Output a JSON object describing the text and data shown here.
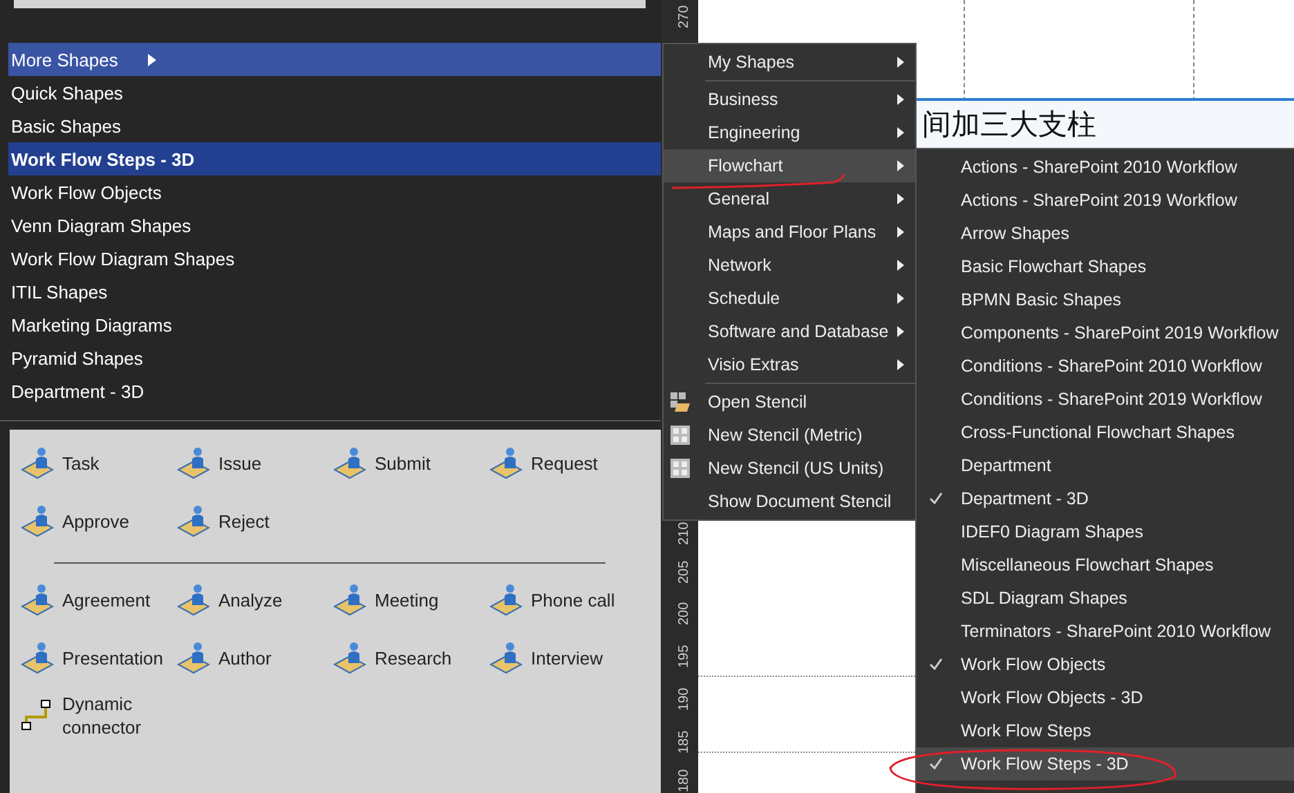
{
  "shape_categories": [
    {
      "label": "More Shapes",
      "open": true,
      "has_submenu": true,
      "selected": false
    },
    {
      "label": "Quick Shapes",
      "open": false,
      "has_submenu": false,
      "selected": false
    },
    {
      "label": "Basic Shapes",
      "open": false,
      "has_submenu": false,
      "selected": false
    },
    {
      "label": "Work Flow Steps - 3D",
      "open": false,
      "has_submenu": false,
      "selected": true
    },
    {
      "label": "Work Flow Objects",
      "open": false,
      "has_submenu": false,
      "selected": false
    },
    {
      "label": "Venn Diagram Shapes",
      "open": false,
      "has_submenu": false,
      "selected": false
    },
    {
      "label": "Work Flow Diagram Shapes",
      "open": false,
      "has_submenu": false,
      "selected": false
    },
    {
      "label": "ITIL Shapes",
      "open": false,
      "has_submenu": false,
      "selected": false
    },
    {
      "label": "Marketing Diagrams",
      "open": false,
      "has_submenu": false,
      "selected": false
    },
    {
      "label": "Pyramid Shapes",
      "open": false,
      "has_submenu": false,
      "selected": false
    },
    {
      "label": "Department - 3D",
      "open": false,
      "has_submenu": false,
      "selected": false
    }
  ],
  "stencil_groups": [
    [
      {
        "label": "Task",
        "kind": "figure"
      },
      {
        "label": "Issue",
        "kind": "figure"
      },
      {
        "label": "Submit",
        "kind": "figure"
      },
      {
        "label": "Request",
        "kind": "figure"
      },
      {
        "label": "Approve",
        "kind": "figure"
      },
      {
        "label": "Reject",
        "kind": "figure"
      }
    ],
    [
      {
        "label": "Agreement",
        "kind": "figure"
      },
      {
        "label": "Analyze",
        "kind": "figure"
      },
      {
        "label": "Meeting",
        "kind": "figure"
      },
      {
        "label": "Phone call",
        "kind": "figure"
      },
      {
        "label": "Presentation",
        "kind": "figure"
      },
      {
        "label": "Author",
        "kind": "figure"
      },
      {
        "label": "Research",
        "kind": "figure"
      },
      {
        "label": "Interview",
        "kind": "figure"
      },
      {
        "label": "Dynamic connector",
        "kind": "connector"
      }
    ]
  ],
  "ruler_labels": [
    "270",
    "210",
    "205",
    "200",
    "195",
    "190",
    "185",
    "180"
  ],
  "canvas_heading": "间加三大支柱",
  "more_shapes_menu": [
    {
      "label": "My Shapes",
      "kind": "submenu",
      "selected": false,
      "separator_after": true
    },
    {
      "label": "Business",
      "kind": "submenu",
      "selected": false,
      "separator_after": false
    },
    {
      "label": "Engineering",
      "kind": "submenu",
      "selected": false,
      "separator_after": false
    },
    {
      "label": "Flowchart",
      "kind": "submenu",
      "selected": true,
      "separator_after": false
    },
    {
      "label": "General",
      "kind": "submenu",
      "selected": false,
      "separator_after": false
    },
    {
      "label": "Maps and Floor Plans",
      "kind": "submenu",
      "selected": false,
      "separator_after": false
    },
    {
      "label": "Network",
      "kind": "submenu",
      "selected": false,
      "separator_after": false
    },
    {
      "label": "Schedule",
      "kind": "submenu",
      "selected": false,
      "separator_after": false
    },
    {
      "label": "Software and Database",
      "kind": "submenu",
      "selected": false,
      "separator_after": false
    },
    {
      "label": "Visio Extras",
      "kind": "submenu",
      "selected": false,
      "separator_after": true
    },
    {
      "label": "Open Stencil",
      "kind": "open",
      "selected": false,
      "separator_after": false
    },
    {
      "label": "New Stencil (Metric)",
      "kind": "new",
      "selected": false,
      "separator_after": false
    },
    {
      "label": "New Stencil (US Units)",
      "kind": "new",
      "selected": false,
      "separator_after": false
    },
    {
      "label": "Show Document Stencil",
      "kind": "command",
      "selected": false,
      "separator_after": false
    }
  ],
  "flowchart_menu": [
    {
      "label": "Actions - SharePoint 2010 Workflow",
      "checked": false,
      "selected": false
    },
    {
      "label": "Actions - SharePoint 2019 Workflow",
      "checked": false,
      "selected": false
    },
    {
      "label": "Arrow Shapes",
      "checked": false,
      "selected": false
    },
    {
      "label": "Basic Flowchart Shapes",
      "checked": false,
      "selected": false
    },
    {
      "label": "BPMN Basic Shapes",
      "checked": false,
      "selected": false
    },
    {
      "label": "Components - SharePoint 2019 Workflow",
      "checked": false,
      "selected": false
    },
    {
      "label": "Conditions - SharePoint 2010 Workflow",
      "checked": false,
      "selected": false
    },
    {
      "label": "Conditions - SharePoint 2019 Workflow",
      "checked": false,
      "selected": false
    },
    {
      "label": "Cross-Functional Flowchart Shapes",
      "checked": false,
      "selected": false
    },
    {
      "label": "Department",
      "checked": false,
      "selected": false
    },
    {
      "label": "Department - 3D",
      "checked": true,
      "selected": false
    },
    {
      "label": "IDEF0 Diagram Shapes",
      "checked": false,
      "selected": false
    },
    {
      "label": "Miscellaneous Flowchart Shapes",
      "checked": false,
      "selected": false
    },
    {
      "label": "SDL Diagram Shapes",
      "checked": false,
      "selected": false
    },
    {
      "label": "Terminators - SharePoint 2010 Workflow",
      "checked": false,
      "selected": false
    },
    {
      "label": "Work Flow Objects",
      "checked": true,
      "selected": false
    },
    {
      "label": "Work Flow Objects - 3D",
      "checked": false,
      "selected": false
    },
    {
      "label": "Work Flow Steps",
      "checked": false,
      "selected": false
    },
    {
      "label": "Work Flow Steps - 3D",
      "checked": true,
      "selected": true
    }
  ]
}
